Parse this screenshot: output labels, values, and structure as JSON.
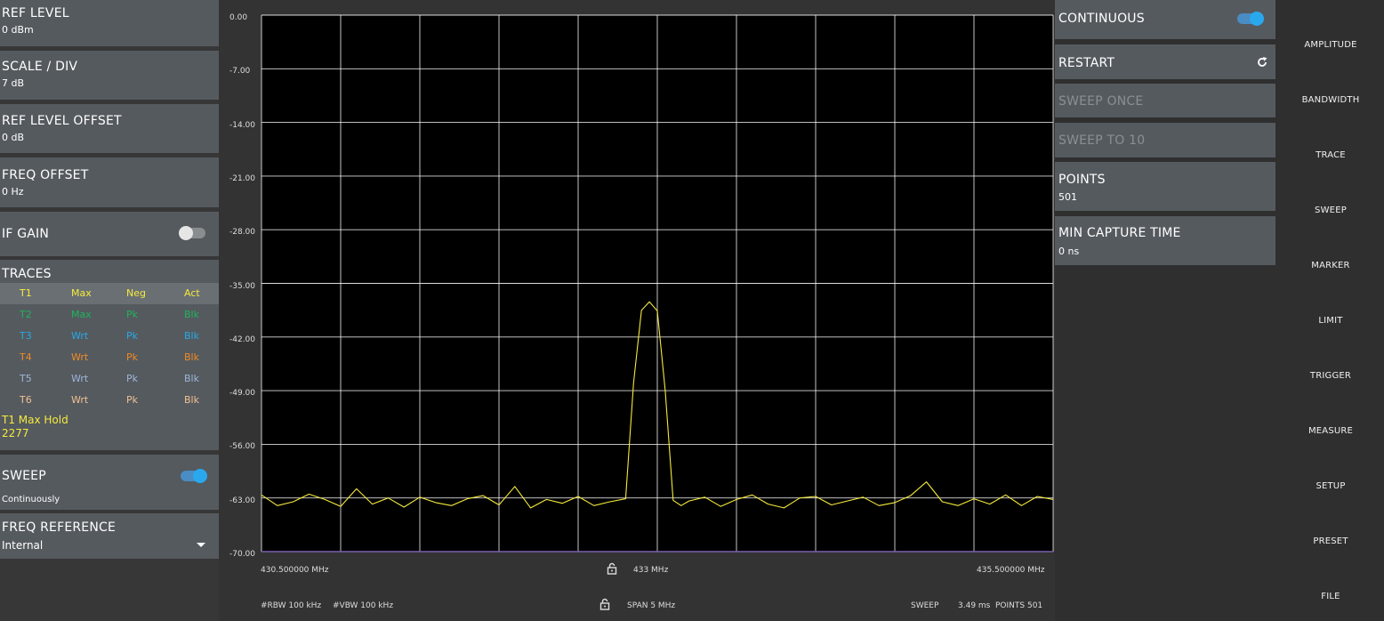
{
  "left_panel": {
    "ref_level": {
      "label": "REF LEVEL",
      "value": "0 dBm"
    },
    "scale_div": {
      "label": "SCALE / DIV",
      "value": "7 dB"
    },
    "ref_level_offset": {
      "label": "REF LEVEL OFFSET",
      "value": "0 dB"
    },
    "freq_offset": {
      "label": "FREQ OFFSET",
      "value": "0 Hz"
    },
    "if_gain": {
      "label": "IF GAIN",
      "enabled": false
    },
    "traces": {
      "label": "TRACES",
      "rows": [
        {
          "id": "T1",
          "mode": "Max",
          "det": "Neg",
          "state": "Act",
          "color": "#f5ea3c",
          "highlight": true
        },
        {
          "id": "T2",
          "mode": "Max",
          "det": "Pk",
          "state": "Blk",
          "color": "#1fb45a",
          "highlight": false
        },
        {
          "id": "T3",
          "mode": "Wrt",
          "det": "Pk",
          "state": "Blk",
          "color": "#27a9e6",
          "highlight": false
        },
        {
          "id": "T4",
          "mode": "Wrt",
          "det": "Pk",
          "state": "Blk",
          "color": "#f08a22",
          "highlight": false
        },
        {
          "id": "T5",
          "mode": "Wrt",
          "det": "Pk",
          "state": "Blk",
          "color": "#9eb4d8",
          "highlight": false
        },
        {
          "id": "T6",
          "mode": "Wrt",
          "det": "Pk",
          "state": "Blk",
          "color": "#f0c090",
          "highlight": false
        }
      ],
      "active_trace": "T1 Max Hold",
      "active_count": "2277",
      "active_color": "#f5ea3c"
    },
    "sweep": {
      "label": "SWEEP",
      "value": "Continuously",
      "enabled": true
    },
    "freq_reference": {
      "label": "FREQ REFERENCE",
      "value": "Internal"
    }
  },
  "plot": {
    "y_labels": [
      "0.00",
      "-7.00",
      "-14.00",
      "-21.00",
      "-28.00",
      "-35.00",
      "-42.00",
      "-49.00",
      "-56.00",
      "-63.00",
      "-70.00"
    ],
    "freq_start": "430.500000 MHz",
    "freq_center": "433 MHz",
    "freq_stop": "435.500000 MHz",
    "rbw": "#RBW 100 kHz",
    "vbw": "#VBW 100 kHz",
    "span": "SPAN 5 MHz",
    "sweep_label": "SWEEP",
    "sweep_time": "3.49 ms",
    "points": "POINTS 501",
    "trace_color": "#f5ea3c",
    "grid_color": "#ffffff",
    "background": "#000000"
  },
  "chart_data": {
    "type": "line",
    "title": "",
    "xlabel": "",
    "ylabel": "",
    "xlim": [
      430.5,
      435.5
    ],
    "ylim": [
      -70,
      0
    ],
    "grid": true,
    "series": [
      {
        "x": [
          430.5,
          430.6,
          430.7,
          430.8,
          430.9,
          431.0,
          431.1,
          431.2,
          431.3,
          431.4,
          431.5,
          431.6,
          431.7,
          431.8,
          431.9,
          432.0,
          432.1,
          432.2,
          432.3,
          432.4,
          432.5,
          432.6,
          432.7,
          432.8,
          432.85,
          432.9,
          432.95,
          433.0,
          433.05,
          433.1,
          433.15,
          433.2,
          433.3,
          433.4,
          433.5,
          433.6,
          433.7,
          433.8,
          433.9,
          434.0,
          434.1,
          434.2,
          434.3,
          434.4,
          434.5,
          434.6,
          434.7,
          434.8,
          434.9,
          435.0,
          435.1,
          435.2,
          435.3,
          435.4,
          435.5
        ],
        "values": [
          -62.6,
          -64.0,
          -63.5,
          -62.5,
          -63.2,
          -64.1,
          -61.8,
          -63.8,
          -63.0,
          -64.2,
          -62.9,
          -63.6,
          -64.0,
          -63.1,
          -62.7,
          -63.9,
          -61.5,
          -64.3,
          -63.2,
          -63.7,
          -62.8,
          -64.0,
          -63.5,
          -63.1,
          -48.0,
          -38.5,
          -37.4,
          -38.6,
          -49.0,
          -63.3,
          -64.0,
          -63.4,
          -62.9,
          -64.1,
          -63.2,
          -62.6,
          -63.8,
          -64.3,
          -63.0,
          -62.8,
          -63.9,
          -63.4,
          -62.9,
          -64.0,
          -63.6,
          -62.7,
          -60.9,
          -63.5,
          -64.0,
          -63.1,
          -63.8,
          -62.6,
          -64.0,
          -62.8,
          -63.2
        ]
      }
    ]
  },
  "right_panel": {
    "continuous": {
      "label": "CONTINUOUS",
      "enabled": true
    },
    "restart": {
      "label": "RESTART"
    },
    "sweep_once": {
      "label": "SWEEP ONCE"
    },
    "sweep_to": {
      "label": "SWEEP TO 10"
    },
    "points": {
      "label": "POINTS",
      "value": "501"
    },
    "min_capture_time": {
      "label": "MIN CAPTURE TIME",
      "value": "0 ns"
    }
  },
  "menu": {
    "items": [
      "AMPLITUDE",
      "BANDWIDTH",
      "TRACE",
      "SWEEP",
      "MARKER",
      "LIMIT",
      "TRIGGER",
      "MEASURE",
      "SETUP",
      "PRESET",
      "FILE"
    ]
  }
}
